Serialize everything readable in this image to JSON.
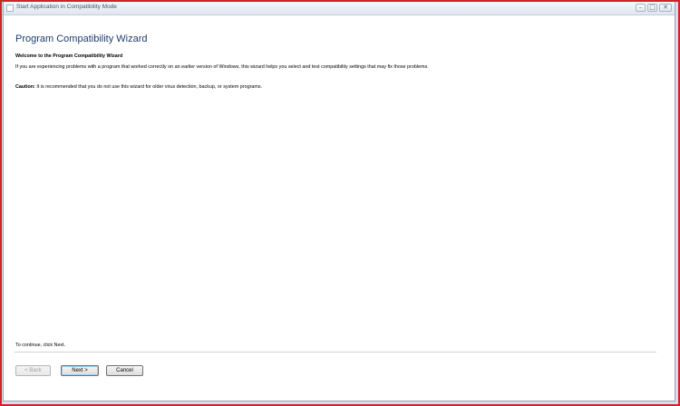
{
  "window": {
    "title": "Start Application in Compatibility Mode",
    "controls": {
      "minimize": "–",
      "maximize": "□",
      "close": "✕"
    }
  },
  "wizard": {
    "heading": "Program Compatibility Wizard",
    "subheading": "Welcome to the Program Compatibility Wizard",
    "intro": "If you are experiencing problems with a program that worked correctly on an earlier version of Windows, this wizard helps you select and test compatibility settings that may fix those problems.",
    "caution_label": "Caution:",
    "caution_text": " It is recommended that you do not use this wizard for older virus detection, backup, or system programs.",
    "continue_text": "To continue, click Next."
  },
  "buttons": {
    "back": "< Back",
    "next": "Next >",
    "cancel": "Cancel",
    "back_enabled": false
  },
  "colors": {
    "frame": "#d4202a",
    "heading": "#1d3d6e"
  }
}
